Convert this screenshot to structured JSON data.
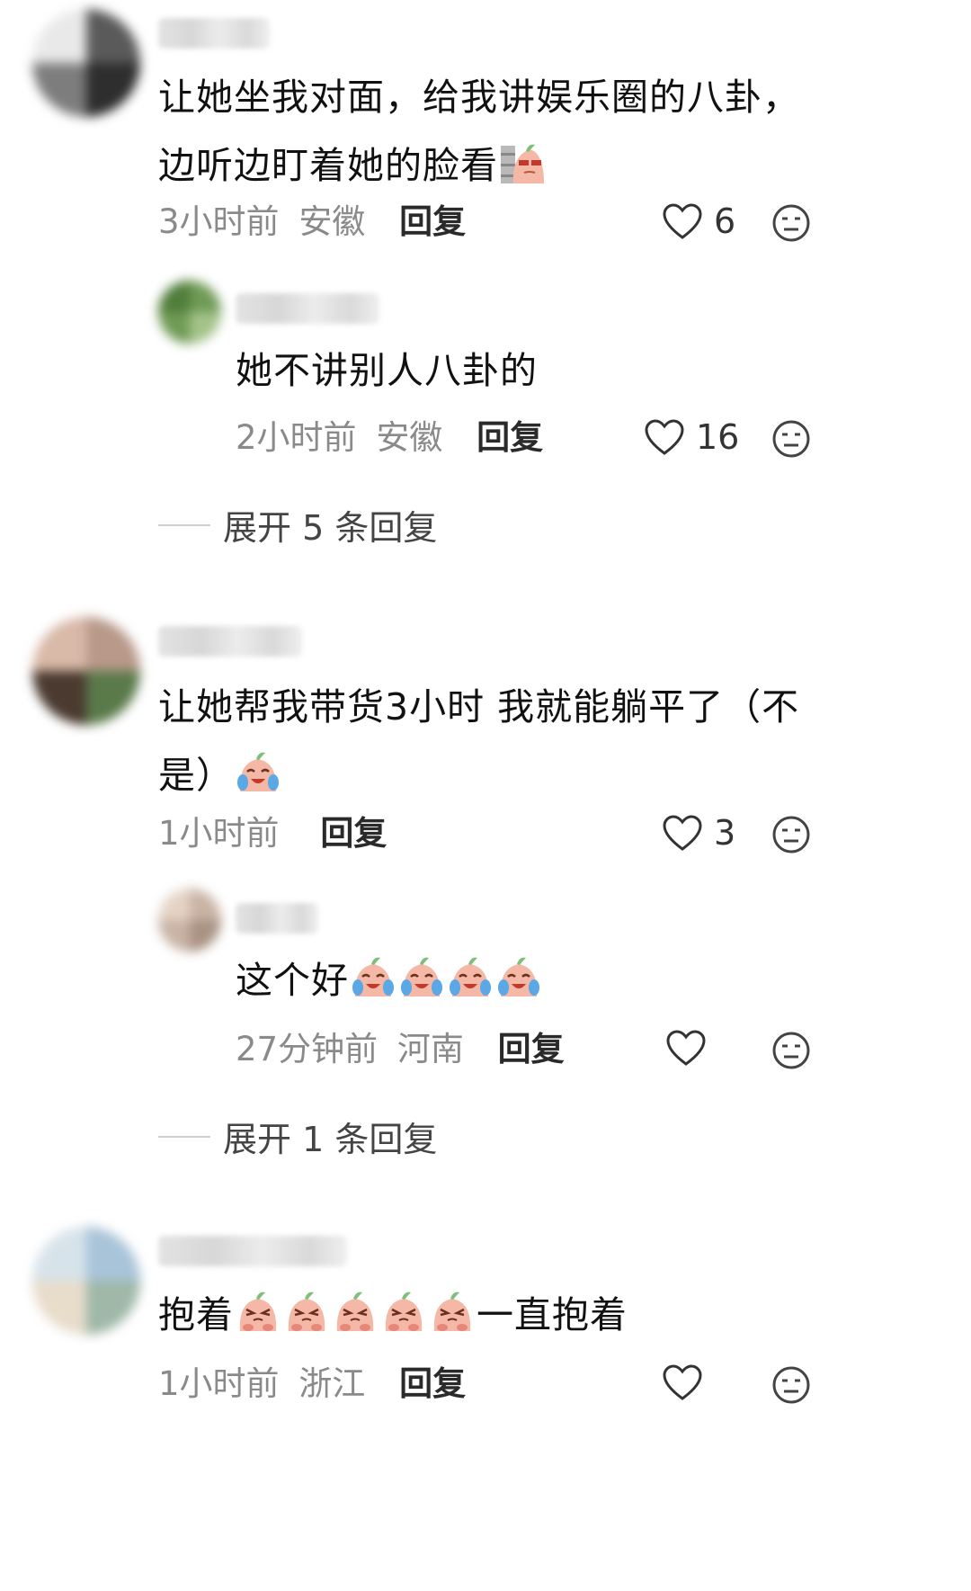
{
  "comments": [
    {
      "text_line1": "让她坐我对面，给我讲娱乐圈的八卦，",
      "text_line2": "边听边盯着她的脸看",
      "emoji": "peeking-peach-emoji",
      "time": "3小时前",
      "location": "安徽",
      "reply_label": "回复",
      "likes": "6",
      "reply": {
        "text": "她不讲别人八卦的",
        "time": "2小时前",
        "location": "安徽",
        "reply_label": "回复",
        "likes": "16"
      },
      "expand_label": "展开 5 条回复"
    },
    {
      "text_line1": "让她帮我带货3小时 我就能躺平了（不",
      "text_line2": "是）",
      "emoji": "crying-laughing-peach-emoji",
      "time": "1小时前",
      "reply_label": "回复",
      "likes": "3",
      "reply": {
        "text": "这个好",
        "emoji": "crying-laughing-peach-emoji",
        "emoji_count": 4,
        "time": "27分钟前",
        "location": "河南",
        "reply_label": "回复",
        "likes": ""
      },
      "expand_label": "展开 1 条回复"
    },
    {
      "text_start": "抱着",
      "emoji": "pleading-peach-emoji",
      "emoji_count": 5,
      "text_end": "一直抱着",
      "time": "1小时前",
      "location": "浙江",
      "reply_label": "回复"
    }
  ],
  "colors": {
    "text": "#111111",
    "meta": "#8a8a8a",
    "reply_label": "#2a2a2a",
    "peach": "#f5b8a6"
  }
}
